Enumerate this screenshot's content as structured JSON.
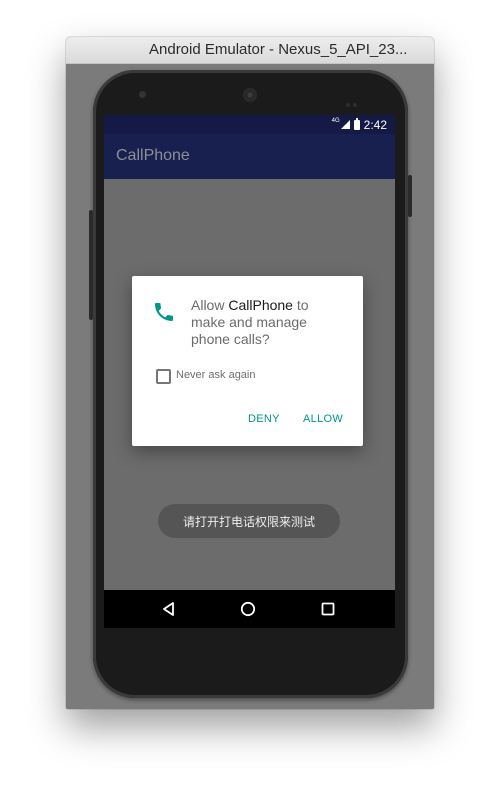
{
  "window": {
    "title": "Android Emulator - Nexus_5_API_23..."
  },
  "statusbar": {
    "network": "4G",
    "time": "2:42"
  },
  "appbar": {
    "title": "CallPhone"
  },
  "dialog": {
    "message_prefix": "Allow ",
    "app_name": "CallPhone",
    "message_suffix": " to make and manage phone calls?",
    "checkbox_label": "Never ask again",
    "checkbox_checked": false,
    "deny_label": "DENY",
    "allow_label": "ALLOW",
    "accent_color": "#009688"
  },
  "toast": {
    "text": "请打开打电话权限来测试"
  },
  "navbar": {
    "icons": [
      "back-icon",
      "home-icon",
      "recents-icon"
    ]
  }
}
